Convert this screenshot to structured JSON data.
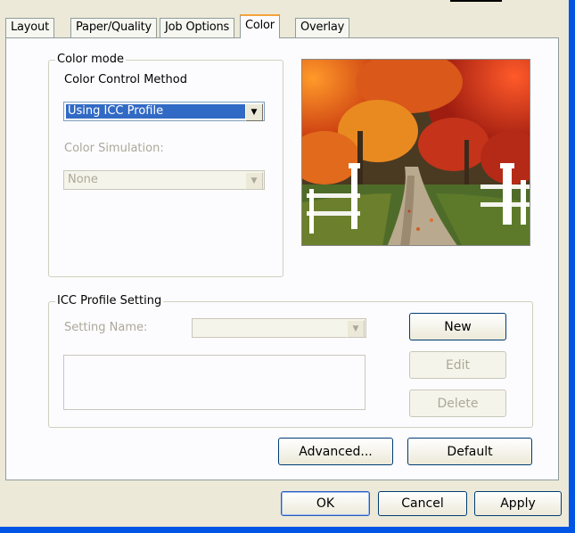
{
  "tabs": [
    "Layout",
    "Paper/Quality",
    "Job Options",
    "Color",
    "Overlay"
  ],
  "color_mode": {
    "legend": "Color mode",
    "method_label": "Color Control Method",
    "method_value": "Using ICC Profile",
    "simulation_label": "Color Simulation:",
    "simulation_value": "None"
  },
  "icc": {
    "legend": "ICC Profile Setting",
    "setting_name_label": "Setting Name:",
    "setting_name_value": "",
    "new_label": "New",
    "edit_label": "Edit",
    "delete_label": "Delete"
  },
  "panel_buttons": {
    "advanced": "Advanced...",
    "default": "Default"
  },
  "dialog_buttons": {
    "ok": "OK",
    "cancel": "Cancel",
    "apply": "Apply"
  }
}
